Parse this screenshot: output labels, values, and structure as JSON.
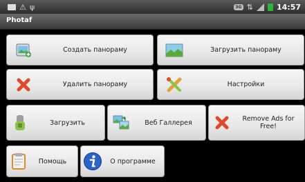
{
  "status_bar": {
    "time": "14:57",
    "network_label": "3G"
  },
  "app": {
    "title": "Photaf"
  },
  "buttons": [
    {
      "label": "Создать панораму",
      "icon": "create-panorama-icon"
    },
    {
      "label": "Загрузить панораму",
      "icon": "landscape-icon"
    },
    {
      "label": "Удалить панораму",
      "icon": "delete-x-icon"
    },
    {
      "label": "Настройки",
      "icon": "settings-tools-icon"
    },
    {
      "label": "Загрузить",
      "icon": "upload-icon"
    },
    {
      "label": "Веб Галлерея",
      "icon": "web-gallery-icon"
    },
    {
      "label": "Remove Ads for Free!",
      "icon": "delete-x-icon"
    },
    {
      "label": "Помощь",
      "icon": "clipboard-icon"
    },
    {
      "label": "О программе",
      "icon": "info-icon"
    }
  ],
  "colors": {
    "button_text": "#222222",
    "delete_red": "#e2492a",
    "info_blue": "#2a63c9",
    "battery_green": "#2db33a"
  }
}
